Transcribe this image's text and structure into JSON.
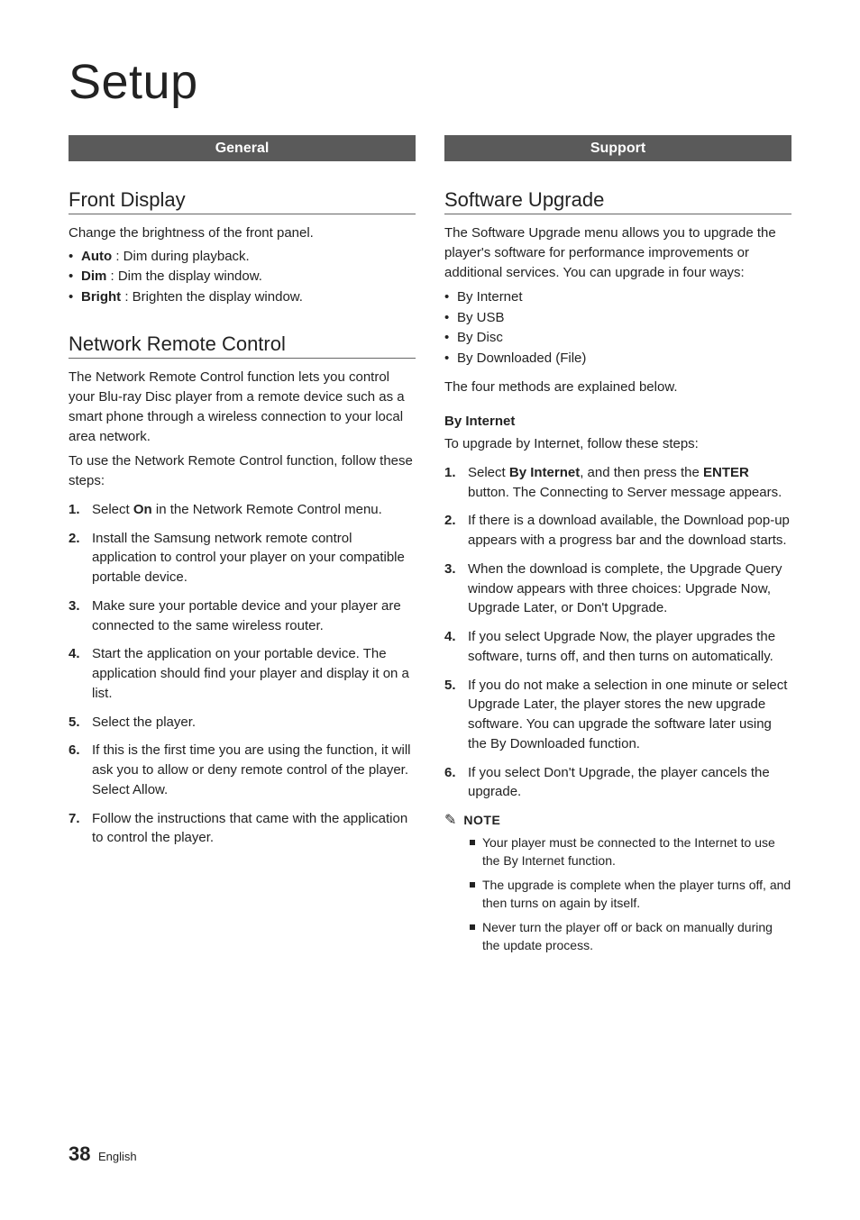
{
  "title": "Setup",
  "left": {
    "bar": "General",
    "front_display": {
      "heading": "Front Display",
      "intro": "Change the brightness of the front panel.",
      "items": {
        "auto_b": "Auto",
        "auto_t": " : Dim during playback.",
        "dim_b": "Dim",
        "dim_t": " : Dim the display window.",
        "bright_b": "Bright",
        "bright_t": " : Brighten the display window."
      }
    },
    "nrc": {
      "heading": "Network Remote Control",
      "p1": "The Network Remote Control function lets you control your Blu-ray Disc player from a remote device such as a smart phone through a wireless connection to your local area network.",
      "p2": "To use the Network Remote Control function, follow these steps:",
      "steps": {
        "s1a": "Select ",
        "s1b": "On",
        "s1c": " in the Network Remote Control menu.",
        "s2": "Install the Samsung network remote control application to control your player on your compatible portable device.",
        "s3": "Make sure your portable device and your player are connected to the same wireless router.",
        "s4": "Start the application on your portable device. The application should find your player and display it on a list.",
        "s5": "Select the player.",
        "s6": "If this is the first time you are using the function, it will ask you to allow or deny remote control of the player. Select Allow.",
        "s7": "Follow the instructions that came with the application to control the player."
      }
    }
  },
  "right": {
    "bar": "Support",
    "su": {
      "heading": "Software Upgrade",
      "intro": "The Software Upgrade menu allows you to upgrade the player's software for performance improvements or additional services. You can upgrade in four ways:",
      "ways": {
        "w1": "By Internet",
        "w2": "By USB",
        "w3": "By Disc",
        "w4": "By Downloaded (File)"
      },
      "outro": "The four methods are explained below.",
      "by_internet": {
        "heading": "By Internet",
        "lead": "To upgrade by Internet, follow these steps:",
        "steps": {
          "s1a": "Select ",
          "s1b": "By Internet",
          "s1c": ", and then press the ",
          "s1d": "ENTER",
          "s1e": " button. The Connecting to Server message appears.",
          "s2": "If there is a download available, the Download pop-up appears with a progress bar and the download starts.",
          "s3": "When the download is complete, the Upgrade Query window appears with three choices: Upgrade Now, Upgrade Later, or Don't Upgrade.",
          "s4": "If you select Upgrade Now, the player upgrades the software, turns off, and then turns on automatically.",
          "s5": "If you do not make a selection in one minute or select Upgrade Later, the player stores the new upgrade software. You can upgrade the software later using the By Downloaded function.",
          "s6": "If you select Don't Upgrade, the player cancels the upgrade."
        }
      },
      "note": {
        "label": "NOTE",
        "n1": "Your player must be connected to the Internet to use the By Internet function.",
        "n2": "The upgrade is complete when the player turns off, and then turns on again by itself.",
        "n3": "Never turn the player off or back on manually during the update process."
      }
    }
  },
  "footer": {
    "page": "38",
    "lang": "English"
  }
}
